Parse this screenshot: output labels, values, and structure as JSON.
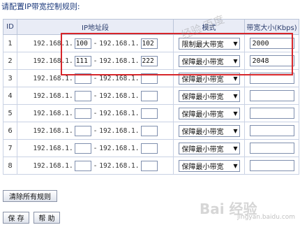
{
  "page": {
    "title": "请配置IP带宽控制规则:",
    "watermark_top": "经验 百度",
    "watermark_logo": "Bai 经验",
    "watermark_url": "jingyan.baidu.com"
  },
  "table": {
    "headers": {
      "id": "ID",
      "ip_range": "IP地址段",
      "mode": "模式",
      "bandwidth": "带宽大小(Kbps)"
    },
    "ip_prefix": "192.168.1.",
    "range_separator": "-",
    "rows": [
      {
        "id": "1",
        "start": "100",
        "end": "102",
        "mode": "限制最大带宽",
        "bandwidth": "2000"
      },
      {
        "id": "2",
        "start": "111",
        "end": "222",
        "mode": "保障最小带宽",
        "bandwidth": "2048"
      },
      {
        "id": "3",
        "start": "",
        "end": "",
        "mode": "保障最小带宽",
        "bandwidth": ""
      },
      {
        "id": "4",
        "start": "",
        "end": "",
        "mode": "保障最小带宽",
        "bandwidth": ""
      },
      {
        "id": "5",
        "start": "",
        "end": "",
        "mode": "保障最小带宽",
        "bandwidth": ""
      },
      {
        "id": "6",
        "start": "",
        "end": "",
        "mode": "保障最小带宽",
        "bandwidth": ""
      },
      {
        "id": "7",
        "start": "",
        "end": "",
        "mode": "保障最小带宽",
        "bandwidth": ""
      },
      {
        "id": "8",
        "start": "",
        "end": "",
        "mode": "保障最小带宽",
        "bandwidth": ""
      }
    ]
  },
  "buttons": {
    "clear_all": "清除所有规则",
    "save": "保 存",
    "help": "帮 助"
  },
  "colors": {
    "highlight": "#d7262a",
    "header_bg": "#e9ecf6",
    "title": "#1c3a7c"
  },
  "icons": {
    "dropdown": "chevron-down-icon"
  }
}
